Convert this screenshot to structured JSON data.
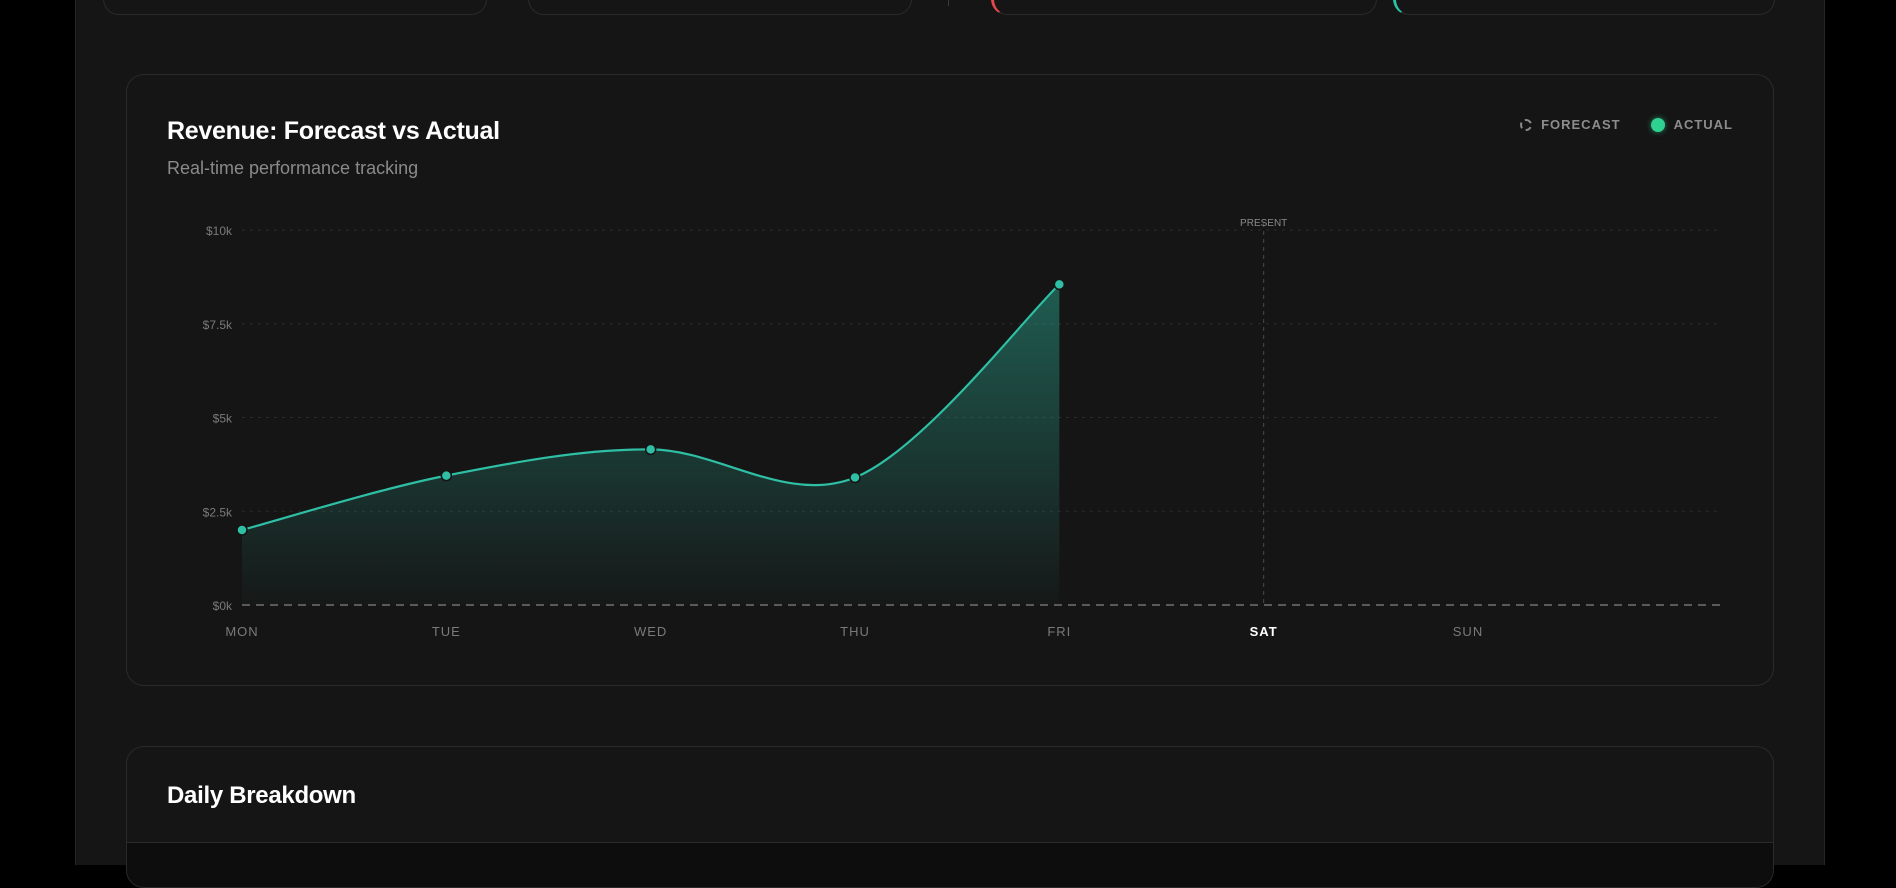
{
  "chart_card": {
    "title": "Revenue: Forecast vs Actual",
    "subtitle": "Real-time performance tracking",
    "legend": {
      "forecast": "FORECAST",
      "actual": "ACTUAL"
    },
    "present_label": "PRESENT"
  },
  "breakdown": {
    "title": "Daily Breakdown"
  },
  "colors": {
    "accent": "#2ebfa5",
    "actual_legend": "#2fd190",
    "top_card_1": "#e5484d",
    "top_card_2": "#2ebfa5"
  },
  "chart_data": {
    "type": "area",
    "title": "Revenue: Forecast vs Actual",
    "subtitle": "Real-time performance tracking",
    "categories": [
      "MON",
      "TUE",
      "WED",
      "THU",
      "FRI",
      "SAT",
      "SUN"
    ],
    "highlight_category": "SAT",
    "present_marker": "SAT",
    "y_ticks": [
      {
        "value": 0,
        "label": "$0k"
      },
      {
        "value": 2500,
        "label": "$2.5k"
      },
      {
        "value": 5000,
        "label": "$5k"
      },
      {
        "value": 7500,
        "label": "$7.5k"
      },
      {
        "value": 10000,
        "label": "$10k"
      }
    ],
    "ylim": [
      0,
      10000
    ],
    "grid": true,
    "legend_position": "top-right",
    "series": [
      {
        "name": "ACTUAL",
        "values": [
          2000,
          3450,
          4150,
          3400,
          8550,
          null,
          null
        ]
      }
    ]
  }
}
